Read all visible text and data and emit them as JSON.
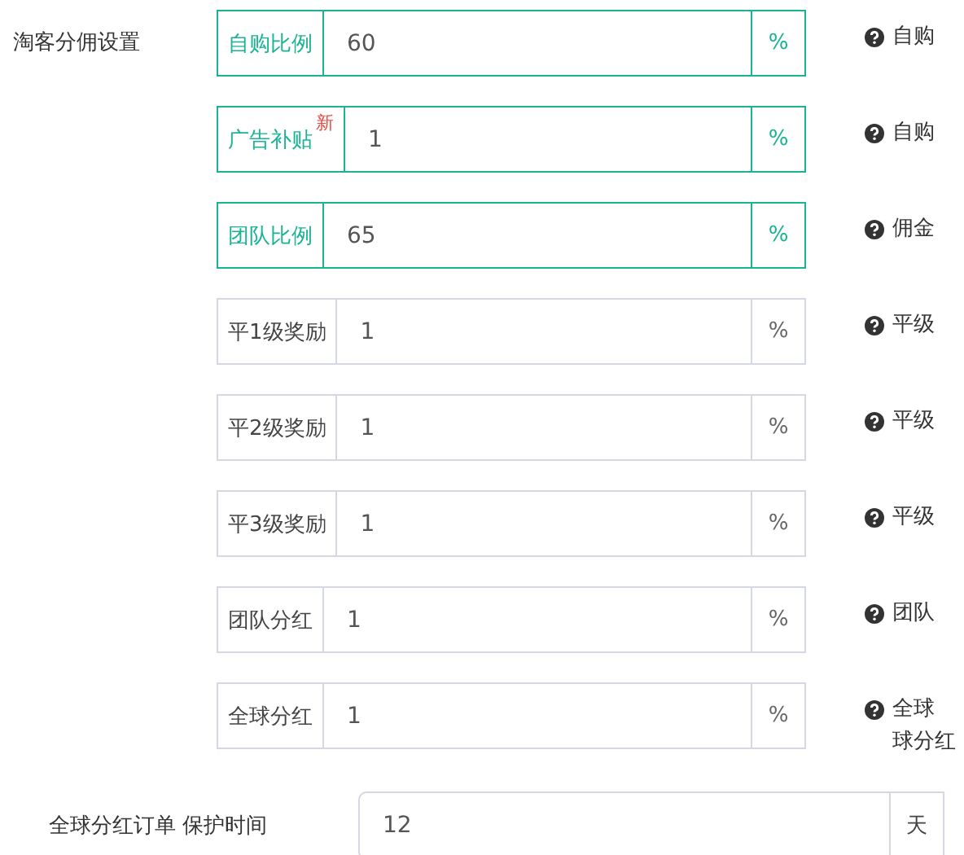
{
  "section_label": "淘客分佣设置",
  "rows": [
    {
      "label": "自购比例",
      "value": "60",
      "unit": "%",
      "active": true,
      "help": [
        "自购"
      ]
    },
    {
      "label": "广告补贴",
      "badge": "新",
      "value": "1",
      "unit": "%",
      "active": true,
      "help": [
        "自购"
      ]
    },
    {
      "label": "团队比例",
      "value": "65",
      "unit": "%",
      "active": true,
      "help": [
        "佣金"
      ]
    },
    {
      "label": "平1级奖励",
      "value": "1",
      "unit": "%",
      "active": false,
      "help": [
        "平级"
      ]
    },
    {
      "label": "平2级奖励",
      "value": "1",
      "unit": "%",
      "active": false,
      "help": [
        "平级"
      ]
    },
    {
      "label": "平3级奖励",
      "value": "1",
      "unit": "%",
      "active": false,
      "help": [
        "平级"
      ]
    },
    {
      "label": "团队分红",
      "value": "1",
      "unit": "%",
      "active": false,
      "help": [
        "团队"
      ]
    },
    {
      "label": "全球分红",
      "value": "1",
      "unit": "%",
      "active": false,
      "help": [
        "全球",
        "球分红"
      ]
    }
  ],
  "protect": {
    "label": "全球分红订单 保护时间",
    "value": "12",
    "unit": "天"
  }
}
